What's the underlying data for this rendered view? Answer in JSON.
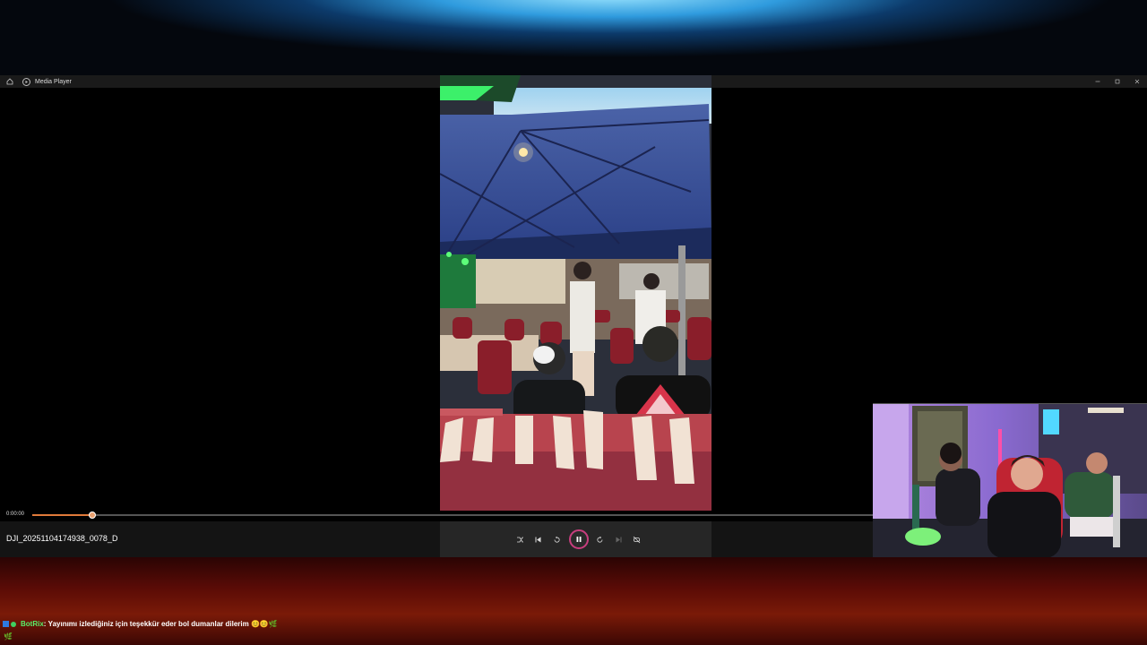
{
  "player": {
    "app_title": "Media Player",
    "file_name": "DJI_20251104174938_0078_D",
    "current_time": "0:00:00",
    "progress": 0.071,
    "window_controls": [
      "minimize-icon",
      "restore-icon",
      "close-icon"
    ]
  },
  "controls": [
    "shuffle-icon",
    "previous-icon",
    "rewind-10-icon",
    "pause-icon",
    "forward-30-icon",
    "next-icon",
    "repeat-off-icon"
  ],
  "chat": {
    "username": "BotRix",
    "separator": ": ",
    "message": "Yayınımı izlediğiniz için teşekkür eder bol dumanlar dilerim 😊😊🌿",
    "second_line": "🌿"
  },
  "colors": {
    "accent": "#e07a3a",
    "play_ring": "#c83e7e",
    "chat_user": "#58f06a"
  }
}
